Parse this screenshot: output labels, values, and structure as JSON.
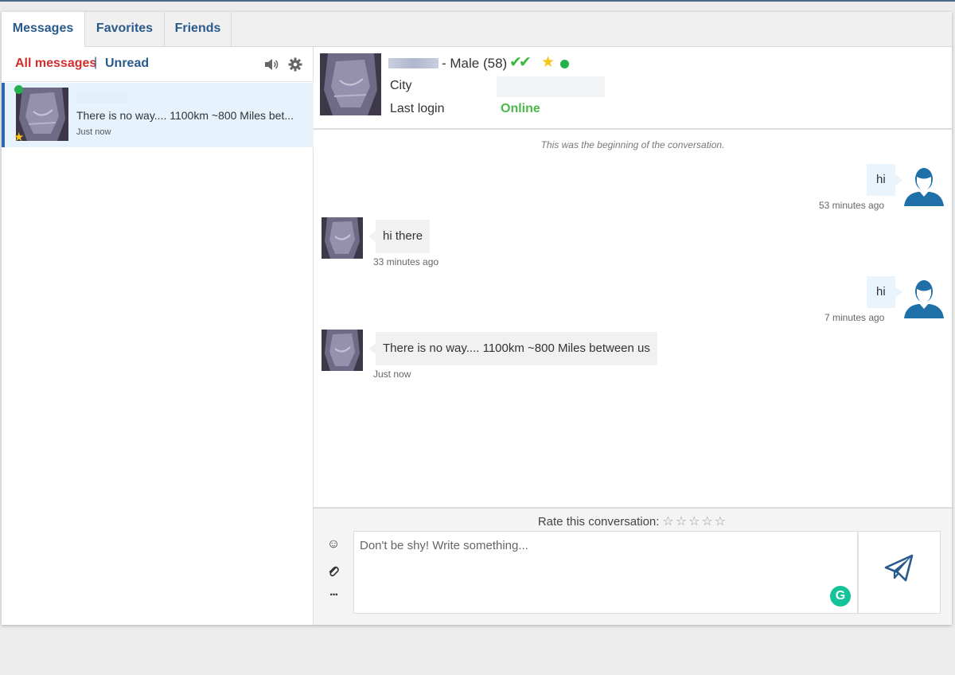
{
  "tabs": [
    {
      "label": "Messages",
      "active": true
    },
    {
      "label": "Favorites",
      "active": false
    },
    {
      "label": "Friends",
      "active": false
    }
  ],
  "filters": {
    "all": "All messages",
    "separator": "|",
    "unread": "Unread"
  },
  "conversation_list": [
    {
      "preview": "There is no way.... 1100km ~800 Miles bet...",
      "time": "Just now",
      "online": true,
      "favorite": true
    }
  ],
  "profile": {
    "name_suffix": "- Male (58)",
    "checks": "✔✔",
    "star": "★",
    "city_label": "City",
    "last_login_label": "Last login",
    "last_login_value": "Online"
  },
  "conversation": {
    "begin_note": "This was the beginning of the conversation.",
    "messages": [
      {
        "direction": "out",
        "text": "hi",
        "time": "53 minutes ago"
      },
      {
        "direction": "in",
        "text": "hi there",
        "time": "33 minutes ago"
      },
      {
        "direction": "out",
        "text": "hi",
        "time": "7 minutes ago"
      },
      {
        "direction": "in",
        "text": "There is no way.... 1100km ~800 Miles between us",
        "time": "Just now"
      }
    ]
  },
  "composer": {
    "rate_label": "Rate this conversation:",
    "rate_stars": "☆☆☆☆☆",
    "placeholder": "Don't be shy! Write something...",
    "emoji": "☺",
    "more": "···",
    "grammarly": "G"
  },
  "colors": {
    "accent": "#2a5a8c",
    "active_filter": "#d12e2e",
    "online": "#22b14c",
    "selected_row": "#e6f3fd"
  }
}
